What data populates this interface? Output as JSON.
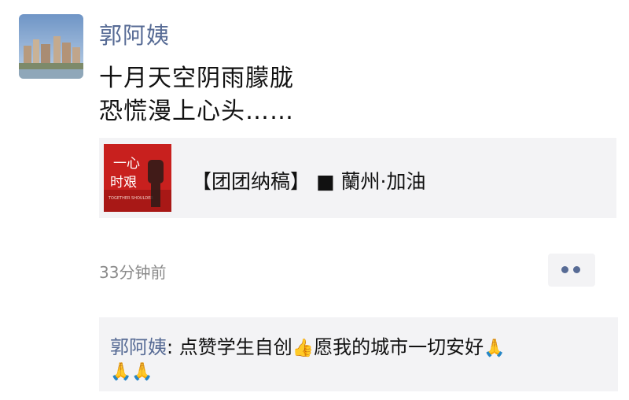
{
  "author": "郭阿姨",
  "post": {
    "line1": "十月天空阴雨朦胧",
    "line2": "恐慌漫上心头……"
  },
  "link_card": {
    "title": "【团团纳稿】 ■ 蘭州·加油",
    "thumb_text_top": "一心",
    "thumb_text_bottom": "时艰",
    "thumb_small_text": "TOGETHER SHOULDER",
    "thumb_color": "#c8201e"
  },
  "timestamp": "33分钟前",
  "more_icon": "more-dots-icon",
  "comment": {
    "commenter": "郭阿姨",
    "separator": ": ",
    "text_part1": "点赞学生自创",
    "emoji1": "👍",
    "text_part2": "愿我的城市一切安好",
    "emoji2": "🙏",
    "line2_emoji": "🙏🙏"
  },
  "colors": {
    "name_blue": "#576b95",
    "card_bg": "#f3f3f5",
    "timestamp_gray": "#8a8a8a"
  }
}
